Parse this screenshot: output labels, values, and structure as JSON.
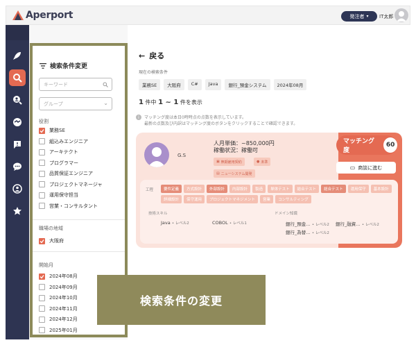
{
  "header": {
    "logo_text": "Aperport",
    "role_label": "発注者",
    "user_name": "IT太郎"
  },
  "sidebar": {
    "icons": [
      "rocket-icon",
      "search-icon",
      "magnify-user-icon",
      "handshake-icon",
      "chat-alert-icon",
      "chat-icon",
      "team-icon",
      "star-icon"
    ],
    "active_index": 1
  },
  "filter_panel": {
    "title": "検索条件変更",
    "keyword_placeholder": "キーワード",
    "group_placeholder": "グループ",
    "role_label": "役割",
    "roles": [
      {
        "label": "業務SE",
        "checked": true
      },
      {
        "label": "組込みエンジニア",
        "checked": false
      },
      {
        "label": "アーキテクト",
        "checked": false
      },
      {
        "label": "プログラマー",
        "checked": false
      },
      {
        "label": "品質保証エンジニア",
        "checked": false
      },
      {
        "label": "プロジェクトマネージャ",
        "checked": false
      },
      {
        "label": "運用保守担当",
        "checked": false
      },
      {
        "label": "営業・コンサルタント",
        "checked": false
      }
    ],
    "area_label": "職場の地域",
    "areas": [
      {
        "label": "大阪府",
        "checked": true
      }
    ],
    "start_label": "開始月",
    "months": [
      {
        "label": "2024年08月",
        "checked": true
      },
      {
        "label": "2024年09月",
        "checked": false
      },
      {
        "label": "2024年10月",
        "checked": false
      },
      {
        "label": "2024年11月",
        "checked": false
      },
      {
        "label": "2024年12月",
        "checked": false
      },
      {
        "label": "2025年01月",
        "checked": false
      }
    ]
  },
  "main": {
    "back_label": "戻る",
    "current_label": "現在の検索条件",
    "chips": [
      "業務SE",
      "大阪府",
      "C#",
      "Java",
      "銀行_預金システム",
      "2024年08月"
    ],
    "count_prefix": "1",
    "count_text1": "件中",
    "count_range": "1 ~ 1",
    "count_text2": "件を表示",
    "notice_line1": "マッチング度は本日0時時点の点数を表示しています。",
    "notice_line2": "最新の点数及び内訳はマッチング度のボタンをクリックすることで確認できます。"
  },
  "card": {
    "name": "G.S",
    "price": "人月単価：~850,000円",
    "status": "稼働状況：稼働可",
    "tag_contract": "無期雇用契約",
    "tag_location": "未準",
    "tag_new": "ニューシステム開発",
    "match_label": "マッチング度",
    "match_score": "60",
    "meet_label": "商談に進む",
    "process_label": "工程",
    "process_tags": [
      {
        "label": "要件定義",
        "dark": true
      },
      {
        "label": "方式設計",
        "dark": false
      },
      {
        "label": "外部設計",
        "dark": true
      },
      {
        "label": "内部設計",
        "dark": false
      },
      {
        "label": "製造",
        "dark": false
      },
      {
        "label": "単体テスト",
        "dark": false
      },
      {
        "label": "結合テスト",
        "dark": false
      },
      {
        "label": "総合テスト",
        "dark": true
      },
      {
        "label": "運用保守",
        "dark": false
      },
      {
        "label": "基本設計",
        "dark": false
      },
      {
        "label": "詳細設計",
        "dark": false
      },
      {
        "label": "保守運用",
        "dark": false
      },
      {
        "label": "プロジェクトマネジメント",
        "dark": false
      },
      {
        "label": "営業",
        "dark": false
      },
      {
        "label": "コンサルティング",
        "dark": false
      }
    ],
    "skill_label": "技術スキル",
    "domain_label": "ドメイン知識",
    "skills": [
      {
        "name": "Java",
        "level": "• レベル2"
      },
      {
        "name": "COBOL",
        "level": "• レベル1"
      }
    ],
    "domains": [
      {
        "name": "銀行_預金…",
        "level": "• レベル2"
      },
      {
        "name": "銀行_融資…",
        "level": "• レベル2"
      },
      {
        "name": "銀行_為替…",
        "level": "• レベル2"
      }
    ]
  },
  "overlay": {
    "label": "検索条件の変更"
  },
  "colors": {
    "accent": "#e46a52",
    "navy": "#2e3452",
    "olive": "#8f8a5b"
  }
}
